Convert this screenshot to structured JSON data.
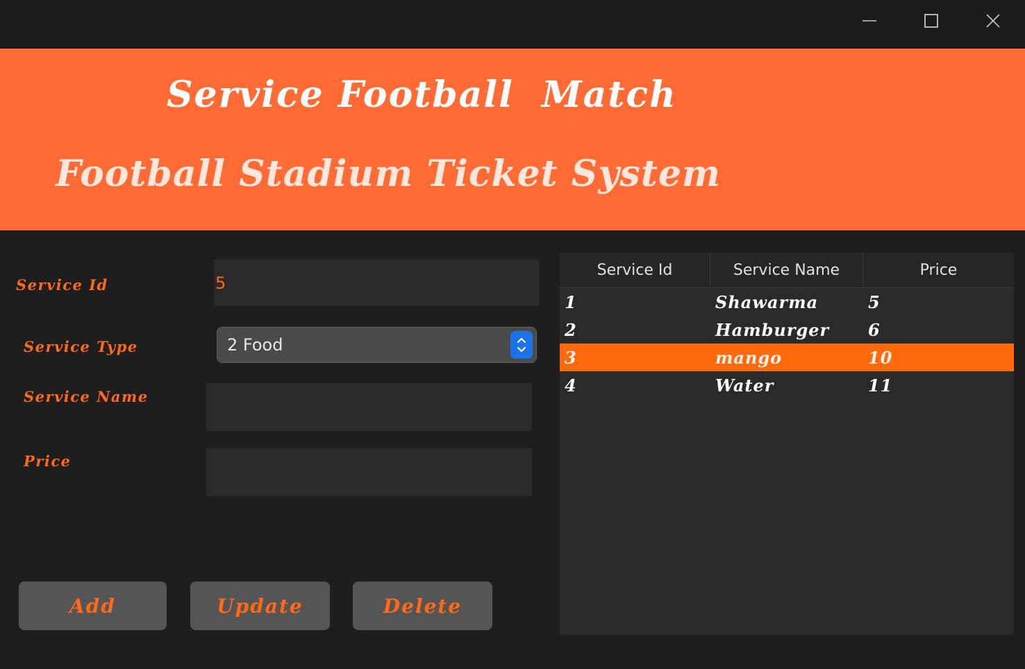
{
  "window": {
    "controls": {
      "minimize_icon": "minimize-icon",
      "maximize_icon": "maximize-icon",
      "close_icon": "close-icon"
    }
  },
  "banner": {
    "title": "Service Football  Match",
    "subtitle": "Football Stadium Ticket System",
    "background": "#ff6a35"
  },
  "form": {
    "service_id": {
      "label": "Service Id",
      "value": "5"
    },
    "service_type": {
      "label": "Service Type",
      "value": "2 Food"
    },
    "service_name": {
      "label": "Service Name",
      "value": ""
    },
    "price": {
      "label": "Price",
      "value": ""
    }
  },
  "buttons": {
    "add": "Add",
    "update": "Update",
    "delete": "Delete"
  },
  "table": {
    "columns": [
      "Service Id",
      "Service Name",
      "Price"
    ],
    "rows": [
      {
        "id": "1",
        "name": "Shawarma",
        "price": "5",
        "selected": false
      },
      {
        "id": "2",
        "name": "Hamburger",
        "price": "6",
        "selected": false
      },
      {
        "id": "3",
        "name": "mango",
        "price": "10",
        "selected": true
      },
      {
        "id": "4",
        "name": "Water",
        "price": "11",
        "selected": false
      }
    ]
  },
  "colors": {
    "accent": "#ff6a1a",
    "selected_row": "#ff6a0d",
    "background": "#1e1e1e"
  }
}
